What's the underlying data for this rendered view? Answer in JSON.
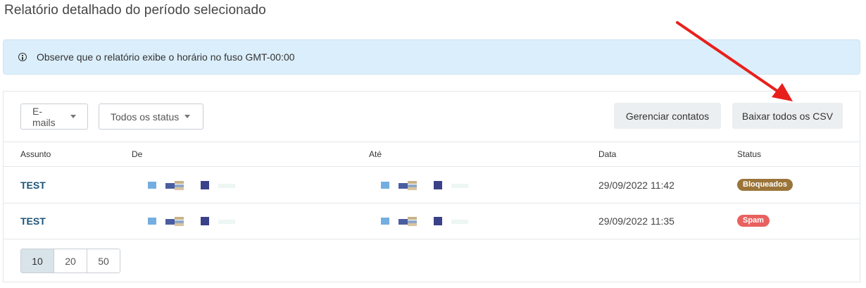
{
  "page": {
    "title": "Relatório detalhado do período selecionado"
  },
  "notice": {
    "icon": "info-icon",
    "text": "Observe que o relatório exibe o horário no fuso GMT-00:00"
  },
  "filters": {
    "type_label": "E-mails",
    "status_label": "Todos os status"
  },
  "actions": {
    "manage_contacts": "Gerenciar contatos",
    "download_csv": "Baixar todos os CSV"
  },
  "table": {
    "columns": [
      "Assunto",
      "De",
      "Até",
      "Data",
      "Status"
    ],
    "rows": [
      {
        "subject": "TEST",
        "date": "29/09/2022 11:42",
        "status": "Bloqueados",
        "status_color": "#9a7438"
      },
      {
        "subject": "TEST",
        "date": "29/09/2022 11:35",
        "status": "Spam",
        "status_color": "#e8615f"
      }
    ]
  },
  "pagination": {
    "sizes": [
      "10",
      "20",
      "50"
    ],
    "selected": "10"
  },
  "annotation": {
    "arrow_color": "#e8201c"
  }
}
